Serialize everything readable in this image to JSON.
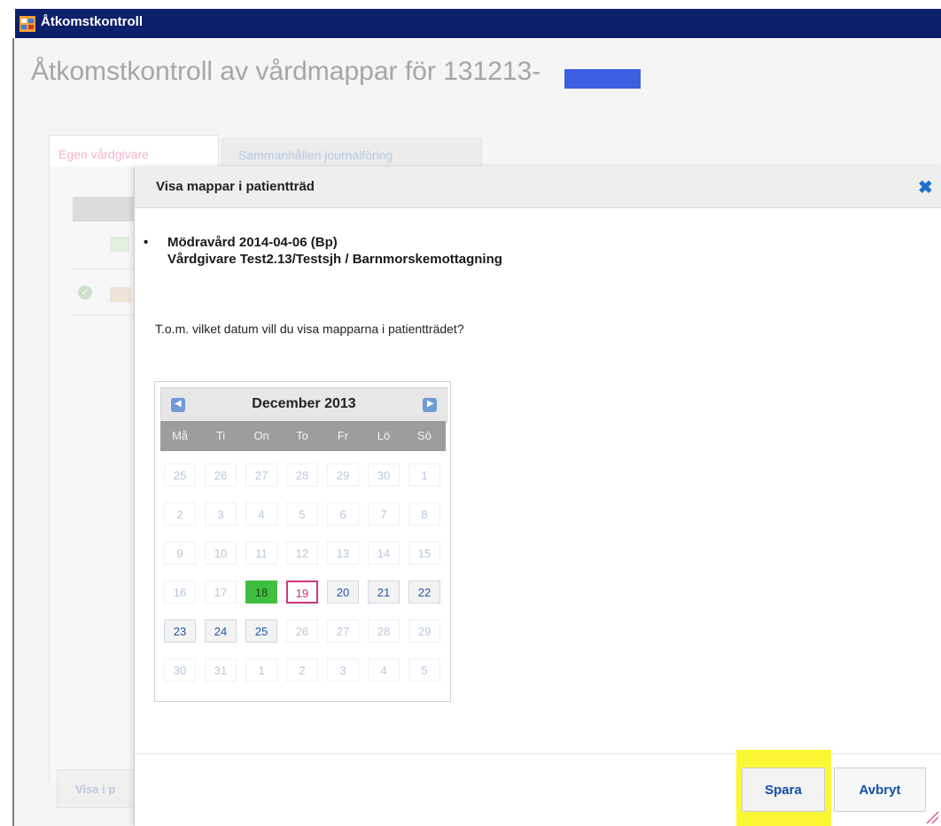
{
  "window": {
    "title": "Åtkomstkontroll",
    "icon": "app-window-icon"
  },
  "page": {
    "title": "Åtkomstkontroll av vårdmappar för 131213-"
  },
  "tabs": [
    {
      "label": "Egen vårdgivare",
      "active": true
    },
    {
      "label": "Sammanhållen journalföring",
      "active": false
    }
  ],
  "background": {
    "button_label": "Visa i p"
  },
  "modal": {
    "title": "Visa mappar i patientträd",
    "close_icon": "close-icon",
    "folder": {
      "line1": "Mödravård 2014-04-06 (Bp)",
      "line2": "Vårdgivare Test2.13/Testsjh / Barnmorskemottagning"
    },
    "question": "T.o.m. vilket datum vill du visa mapparna i patientträdet?",
    "calendar": {
      "month": "December 2013",
      "prev_icon": "chevron-left-icon",
      "next_icon": "chevron-right-icon",
      "weekdays": [
        "Må",
        "Ti",
        "On",
        "To",
        "Fr",
        "Lö",
        "Sö"
      ],
      "weeks": [
        [
          {
            "d": "25",
            "s": "dis"
          },
          {
            "d": "26",
            "s": "dis"
          },
          {
            "d": "27",
            "s": "dis"
          },
          {
            "d": "28",
            "s": "dis"
          },
          {
            "d": "29",
            "s": "dis"
          },
          {
            "d": "30",
            "s": "dis"
          },
          {
            "d": "1",
            "s": "dis"
          }
        ],
        [
          {
            "d": "2",
            "s": "dis"
          },
          {
            "d": "3",
            "s": "dis"
          },
          {
            "d": "4",
            "s": "dis"
          },
          {
            "d": "5",
            "s": "dis"
          },
          {
            "d": "6",
            "s": "dis"
          },
          {
            "d": "7",
            "s": "dis"
          },
          {
            "d": "8",
            "s": "dis"
          }
        ],
        [
          {
            "d": "9",
            "s": "dis"
          },
          {
            "d": "10",
            "s": "dis"
          },
          {
            "d": "11",
            "s": "dis"
          },
          {
            "d": "12",
            "s": "dis"
          },
          {
            "d": "13",
            "s": "dis"
          },
          {
            "d": "14",
            "s": "dis"
          },
          {
            "d": "15",
            "s": "dis"
          }
        ],
        [
          {
            "d": "16",
            "s": "dis"
          },
          {
            "d": "17",
            "s": "dis"
          },
          {
            "d": "18",
            "s": "sel"
          },
          {
            "d": "19",
            "s": "today"
          },
          {
            "d": "20",
            "s": "en"
          },
          {
            "d": "21",
            "s": "en"
          },
          {
            "d": "22",
            "s": "en"
          }
        ],
        [
          {
            "d": "23",
            "s": "en"
          },
          {
            "d": "24",
            "s": "en"
          },
          {
            "d": "25",
            "s": "en"
          },
          {
            "d": "26",
            "s": "dis"
          },
          {
            "d": "27",
            "s": "dis"
          },
          {
            "d": "28",
            "s": "dis"
          },
          {
            "d": "29",
            "s": "dis"
          }
        ],
        [
          {
            "d": "30",
            "s": "dis"
          },
          {
            "d": "31",
            "s": "dis"
          },
          {
            "d": "1",
            "s": "dis"
          },
          {
            "d": "2",
            "s": "dis"
          },
          {
            "d": "3",
            "s": "dis"
          },
          {
            "d": "4",
            "s": "dis"
          },
          {
            "d": "5",
            "s": "dis"
          }
        ]
      ],
      "selected_date": "18",
      "today_date": "19"
    },
    "buttons": {
      "save": "Spara",
      "cancel": "Avbryt"
    }
  },
  "colors": {
    "titlebar": "#0c1f6a",
    "selected_day": "#3fbf3f",
    "today_border": "#d4337f",
    "save_highlight": "#fbf633",
    "link_blue": "#0f4fa8"
  }
}
